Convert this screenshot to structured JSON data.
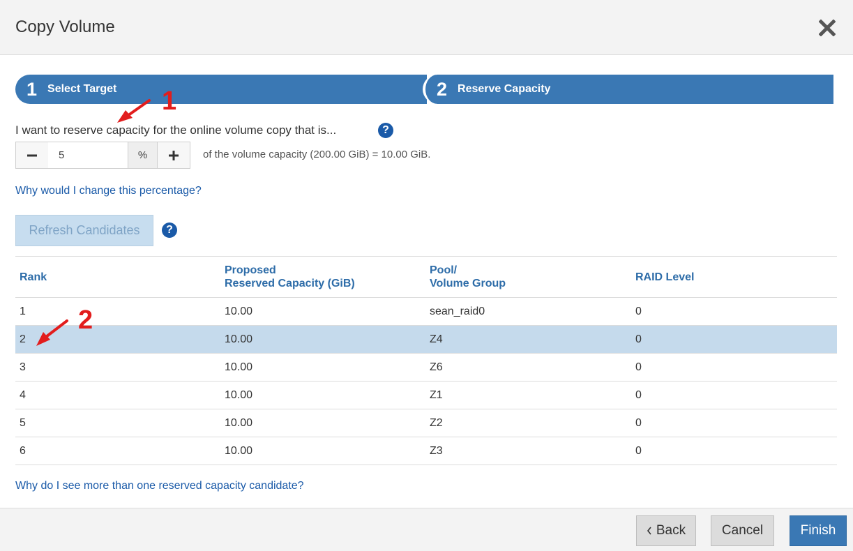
{
  "dialog": {
    "title": "Copy Volume",
    "close_icon": "close-icon"
  },
  "wizard": {
    "steps": [
      {
        "number": "1",
        "label": "Select Target"
      },
      {
        "number": "2",
        "label": "Reserve Capacity"
      }
    ],
    "active_step": 2,
    "color": "#3a78b4"
  },
  "reserve": {
    "prompt": "I want to reserve capacity for the online volume copy that is...",
    "value": "5",
    "unit": "%",
    "note": "of the volume capacity (200.00 GiB) = 10.00 GiB.",
    "help_text": "?"
  },
  "links": {
    "why_change": "Why would I change this percentage?",
    "why_more": "Why do I see more than one reserved capacity candidate?"
  },
  "refresh": {
    "label": "Refresh Candidates",
    "help_text": "?"
  },
  "table": {
    "headers": {
      "rank": "Rank",
      "capacity_line1": "Proposed",
      "capacity_line2": "Reserved Capacity (GiB)",
      "pool_line1": "Pool/",
      "pool_line2": "Volume Group",
      "raid": "RAID Level"
    },
    "rows": [
      {
        "rank": "1",
        "capacity": "10.00",
        "pool": "sean_raid0",
        "raid": "0"
      },
      {
        "rank": "2",
        "capacity": "10.00",
        "pool": "Z4",
        "raid": "0"
      },
      {
        "rank": "3",
        "capacity": "10.00",
        "pool": "Z6",
        "raid": "0"
      },
      {
        "rank": "4",
        "capacity": "10.00",
        "pool": "Z1",
        "raid": "0"
      },
      {
        "rank": "5",
        "capacity": "10.00",
        "pool": "Z2",
        "raid": "0"
      },
      {
        "rank": "6",
        "capacity": "10.00",
        "pool": "Z3",
        "raid": "0"
      }
    ],
    "selected_rank": "2",
    "selected_color": "#c5daec"
  },
  "annotations": {
    "first": "1",
    "second": "2",
    "color": "#e21d1d"
  },
  "footer": {
    "back_label": "Back",
    "cancel_label": "Cancel",
    "finish_label": "Finish"
  }
}
